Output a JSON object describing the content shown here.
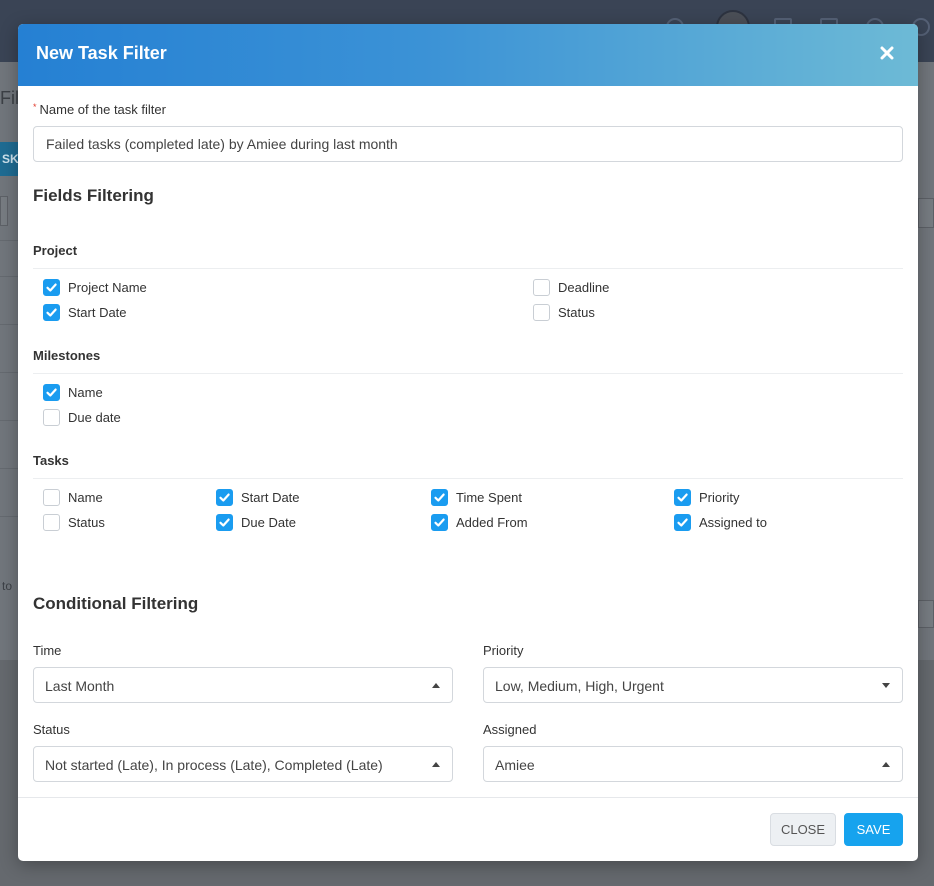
{
  "modal": {
    "title": "New Task Filter"
  },
  "name_field": {
    "label": "Name of the task filter",
    "required_mark": "*",
    "value": "Failed tasks (completed late) by Amiee during last month"
  },
  "fields_filtering": {
    "title": "Fields Filtering",
    "groups": [
      {
        "title": "Project",
        "items": [
          {
            "label": "Project Name",
            "checked": true
          },
          {
            "label": "Start Date",
            "checked": true
          },
          {
            "label": "Deadline",
            "checked": false
          },
          {
            "label": "Status",
            "checked": false
          }
        ]
      },
      {
        "title": "Milestones",
        "items": [
          {
            "label": "Name",
            "checked": true
          },
          {
            "label": "Due date",
            "checked": false
          }
        ]
      },
      {
        "title": "Tasks",
        "items": [
          {
            "label": "Name",
            "checked": false
          },
          {
            "label": "Status",
            "checked": false
          },
          {
            "label": "Start Date",
            "checked": true
          },
          {
            "label": "Due Date",
            "checked": true
          },
          {
            "label": "Time Spent",
            "checked": true
          },
          {
            "label": "Added From",
            "checked": true
          },
          {
            "label": "Priority",
            "checked": true
          },
          {
            "label": "Assigned to",
            "checked": true
          }
        ]
      }
    ]
  },
  "conditional_filtering": {
    "title": "Conditional Filtering",
    "time": {
      "label": "Time",
      "value": "Last Month"
    },
    "priority": {
      "label": "Priority",
      "value": "Low, Medium, High, Urgent"
    },
    "status": {
      "label": "Status",
      "value": "Not started (Late), In process (Late), Completed (Late)"
    },
    "assigned": {
      "label": "Assigned",
      "value": "Amiee"
    }
  },
  "footer": {
    "close_label": "CLOSE",
    "save_label": "SAVE"
  },
  "background": {
    "page_title_fragment": "Fil",
    "button_fragment": "SK",
    "text_fragment": "to"
  },
  "colors": {
    "header_start": "#2580d3",
    "header_end": "#6dbad6",
    "checkbox_checked": "#1a9cf0",
    "save_button": "#16a3ee"
  }
}
